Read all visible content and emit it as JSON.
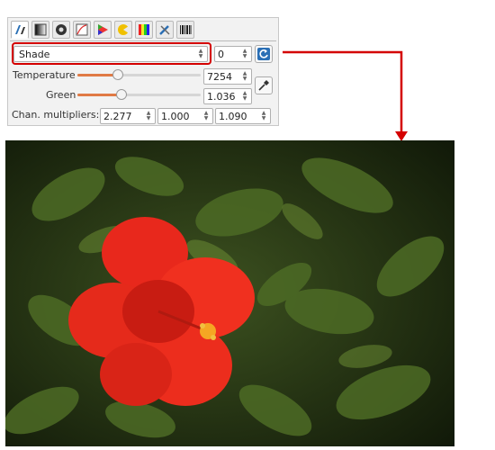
{
  "tabs": [
    {
      "name": "white-balance-tab-icon",
      "active": true
    },
    {
      "name": "exposure-tab-icon",
      "active": false
    },
    {
      "name": "color-tab-icon",
      "active": false
    },
    {
      "name": "curves-tab-icon",
      "active": false
    },
    {
      "name": "raw-tab-icon",
      "active": false
    },
    {
      "name": "lens-tab-icon",
      "active": false
    },
    {
      "name": "spectrum-tab-icon",
      "active": false
    },
    {
      "name": "tools-tab-icon",
      "active": false
    },
    {
      "name": "barcode-tab-icon",
      "active": false
    }
  ],
  "wb": {
    "preset": "Shade",
    "preset_index": "0",
    "temperature_label": "Temperature",
    "temperature_value": "7254",
    "temperature_level": 0.33,
    "green_label": "Green",
    "green_value": "1.036",
    "green_level": 0.36,
    "multipliers_label": "Chan. multipliers:",
    "multipliers": [
      "2.277",
      "1.000",
      "1.090"
    ]
  },
  "colors": {
    "highlight": "#d40000",
    "slider_fill": "#e07a45",
    "reset_icon": "#2a6fb5"
  }
}
